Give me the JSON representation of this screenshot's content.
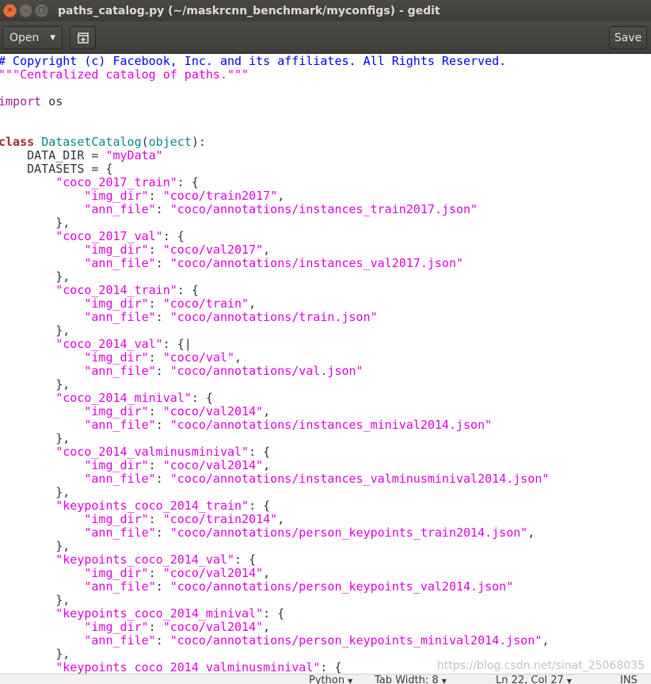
{
  "window": {
    "title": "paths_catalog.py (~/maskrcnn_benchmark/myconfigs) - gedit",
    "close_glyph": "✕",
    "minimize_glyph": "–",
    "maximize_glyph": "□"
  },
  "toolbar": {
    "open_label": "Open",
    "open_arrow": "▼",
    "new_tab_icon": "new-tab-icon",
    "save_label": "Save"
  },
  "editor": {
    "lines": [
      [
        [
          "comment",
          "# Copyright (c) Facebook, Inc. and its affiliates. All Rights Reserved."
        ]
      ],
      [
        [
          "string",
          "\"\"\"Centralized catalog of paths.\"\"\""
        ]
      ],
      [],
      [
        [
          "import",
          "import"
        ],
        [
          "plain",
          " os"
        ]
      ],
      [],
      [],
      [
        [
          "keyword",
          "class"
        ],
        [
          "plain",
          " "
        ],
        [
          "func",
          "DatasetCatalog"
        ],
        [
          "plain",
          "("
        ],
        [
          "builtin",
          "object"
        ],
        [
          "plain",
          "):"
        ]
      ],
      [
        [
          "plain",
          "    DATA_DIR = "
        ],
        [
          "string",
          "\"myData\""
        ]
      ],
      [
        [
          "plain",
          "    DATASETS = {"
        ]
      ],
      [
        [
          "plain",
          "        "
        ],
        [
          "string",
          "\"coco_2017_train\""
        ],
        [
          "plain",
          ": {"
        ]
      ],
      [
        [
          "plain",
          "            "
        ],
        [
          "string",
          "\"img_dir\""
        ],
        [
          "plain",
          ": "
        ],
        [
          "string",
          "\"coco/train2017\""
        ],
        [
          "plain",
          ","
        ]
      ],
      [
        [
          "plain",
          "            "
        ],
        [
          "string",
          "\"ann_file\""
        ],
        [
          "plain",
          ": "
        ],
        [
          "string",
          "\"coco/annotations/instances_train2017.json\""
        ]
      ],
      [
        [
          "plain",
          "        },"
        ]
      ],
      [
        [
          "plain",
          "        "
        ],
        [
          "string",
          "\"coco_2017_val\""
        ],
        [
          "plain",
          ": {"
        ]
      ],
      [
        [
          "plain",
          "            "
        ],
        [
          "string",
          "\"img_dir\""
        ],
        [
          "plain",
          ": "
        ],
        [
          "string",
          "\"coco/val2017\""
        ],
        [
          "plain",
          ","
        ]
      ],
      [
        [
          "plain",
          "            "
        ],
        [
          "string",
          "\"ann_file\""
        ],
        [
          "plain",
          ": "
        ],
        [
          "string",
          "\"coco/annotations/instances_val2017.json\""
        ]
      ],
      [
        [
          "plain",
          "        },"
        ]
      ],
      [
        [
          "plain",
          "        "
        ],
        [
          "string",
          "\"coco_2014_train\""
        ],
        [
          "plain",
          ": {"
        ]
      ],
      [
        [
          "plain",
          "            "
        ],
        [
          "string",
          "\"img_dir\""
        ],
        [
          "plain",
          ": "
        ],
        [
          "string",
          "\"coco/train\""
        ],
        [
          "plain",
          ","
        ]
      ],
      [
        [
          "plain",
          "            "
        ],
        [
          "string",
          "\"ann_file\""
        ],
        [
          "plain",
          ": "
        ],
        [
          "string",
          "\"coco/annotations/train.json\""
        ]
      ],
      [
        [
          "plain",
          "        },"
        ]
      ],
      [
        [
          "plain",
          "        "
        ],
        [
          "string",
          "\"coco_2014_val\""
        ],
        [
          "plain",
          ": {|"
        ]
      ],
      [
        [
          "plain",
          "            "
        ],
        [
          "string",
          "\"img_dir\""
        ],
        [
          "plain",
          ": "
        ],
        [
          "string",
          "\"coco/val\""
        ],
        [
          "plain",
          ","
        ]
      ],
      [
        [
          "plain",
          "            "
        ],
        [
          "string",
          "\"ann_file\""
        ],
        [
          "plain",
          ": "
        ],
        [
          "string",
          "\"coco/annotations/val.json\""
        ]
      ],
      [
        [
          "plain",
          "        },"
        ]
      ],
      [
        [
          "plain",
          "        "
        ],
        [
          "string",
          "\"coco_2014_minival\""
        ],
        [
          "plain",
          ": {"
        ]
      ],
      [
        [
          "plain",
          "            "
        ],
        [
          "string",
          "\"img_dir\""
        ],
        [
          "plain",
          ": "
        ],
        [
          "string",
          "\"coco/val2014\""
        ],
        [
          "plain",
          ","
        ]
      ],
      [
        [
          "plain",
          "            "
        ],
        [
          "string",
          "\"ann_file\""
        ],
        [
          "plain",
          ": "
        ],
        [
          "string",
          "\"coco/annotations/instances_minival2014.json\""
        ]
      ],
      [
        [
          "plain",
          "        },"
        ]
      ],
      [
        [
          "plain",
          "        "
        ],
        [
          "string",
          "\"coco_2014_valminusminival\""
        ],
        [
          "plain",
          ": {"
        ]
      ],
      [
        [
          "plain",
          "            "
        ],
        [
          "string",
          "\"img_dir\""
        ],
        [
          "plain",
          ": "
        ],
        [
          "string",
          "\"coco/val2014\""
        ],
        [
          "plain",
          ","
        ]
      ],
      [
        [
          "plain",
          "            "
        ],
        [
          "string",
          "\"ann_file\""
        ],
        [
          "plain",
          ": "
        ],
        [
          "string",
          "\"coco/annotations/instances_valminusminival2014.json\""
        ]
      ],
      [
        [
          "plain",
          "        },"
        ]
      ],
      [
        [
          "plain",
          "        "
        ],
        [
          "string",
          "\"keypoints_coco_2014_train\""
        ],
        [
          "plain",
          ": {"
        ]
      ],
      [
        [
          "plain",
          "            "
        ],
        [
          "string",
          "\"img_dir\""
        ],
        [
          "plain",
          ": "
        ],
        [
          "string",
          "\"coco/train2014\""
        ],
        [
          "plain",
          ","
        ]
      ],
      [
        [
          "plain",
          "            "
        ],
        [
          "string",
          "\"ann_file\""
        ],
        [
          "plain",
          ": "
        ],
        [
          "string",
          "\"coco/annotations/person_keypoints_train2014.json\""
        ],
        [
          "plain",
          ","
        ]
      ],
      [
        [
          "plain",
          "        },"
        ]
      ],
      [
        [
          "plain",
          "        "
        ],
        [
          "string",
          "\"keypoints_coco_2014_val\""
        ],
        [
          "plain",
          ": {"
        ]
      ],
      [
        [
          "plain",
          "            "
        ],
        [
          "string",
          "\"img_dir\""
        ],
        [
          "plain",
          ": "
        ],
        [
          "string",
          "\"coco/val2014\""
        ],
        [
          "plain",
          ","
        ]
      ],
      [
        [
          "plain",
          "            "
        ],
        [
          "string",
          "\"ann_file\""
        ],
        [
          "plain",
          ": "
        ],
        [
          "string",
          "\"coco/annotations/person_keypoints_val2014.json\""
        ]
      ],
      [
        [
          "plain",
          "        },"
        ]
      ],
      [
        [
          "plain",
          "        "
        ],
        [
          "string",
          "\"keypoints_coco_2014_minival\""
        ],
        [
          "plain",
          ": {"
        ]
      ],
      [
        [
          "plain",
          "            "
        ],
        [
          "string",
          "\"img_dir\""
        ],
        [
          "plain",
          ": "
        ],
        [
          "string",
          "\"coco/val2014\""
        ],
        [
          "plain",
          ","
        ]
      ],
      [
        [
          "plain",
          "            "
        ],
        [
          "string",
          "\"ann_file\""
        ],
        [
          "plain",
          ": "
        ],
        [
          "string",
          "\"coco/annotations/person_keypoints_minival2014.json\""
        ],
        [
          "plain",
          ","
        ]
      ],
      [
        [
          "plain",
          "        },"
        ]
      ],
      [
        [
          "plain",
          "        "
        ],
        [
          "string",
          "\"keypoints_coco_2014_valminusminival\""
        ],
        [
          "plain",
          ": {"
        ]
      ]
    ],
    "watermark": "https://blog.csdn.net/sinat_25068035"
  },
  "statusbar": {
    "language": "Python",
    "tab_width": "Tab Width: 8",
    "position": "Ln 22, Col 27",
    "mode": "INS",
    "arrow": "▼"
  },
  "colors": {
    "comment": "#0000ff",
    "string": "#e000e0",
    "keyword": "#a52a2a",
    "function": "#008a8c",
    "titlebar": "#3c3b37"
  }
}
